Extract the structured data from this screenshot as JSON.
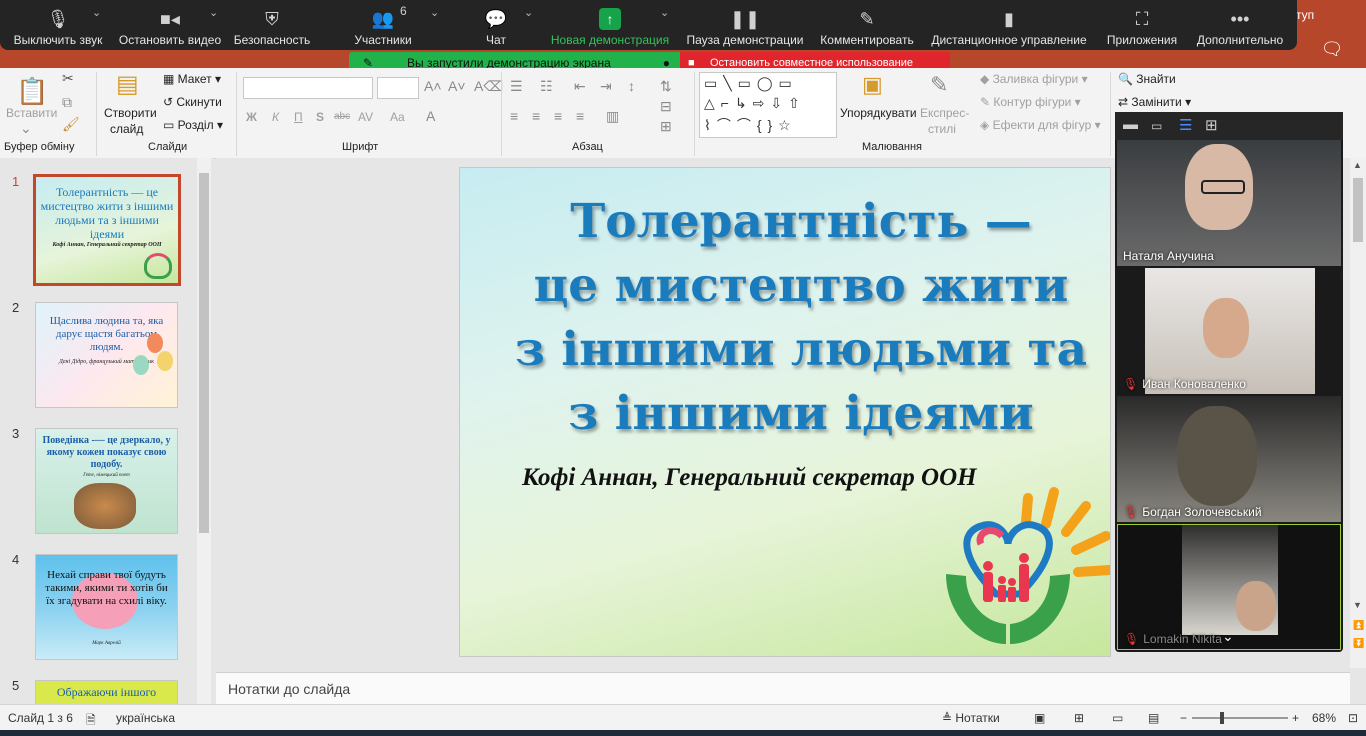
{
  "zoom": {
    "buttons": [
      {
        "label": "Выключить звук",
        "icon": "microphone-icon"
      },
      {
        "label": "Остановить видео",
        "icon": "video-camera-icon"
      },
      {
        "label": "Безопасность",
        "icon": "shield-icon"
      },
      {
        "label": "Участники",
        "icon": "participants-icon"
      },
      {
        "label": "Чат",
        "icon": "chat-icon"
      },
      {
        "label": "Новая демонстрация",
        "icon": "share-screen-icon"
      },
      {
        "label": "Пауза демонстрации",
        "icon": "pause-icon"
      },
      {
        "label": "Комментировать",
        "icon": "pen-icon"
      },
      {
        "label": "Дистанционное управление",
        "icon": "mouse-icon"
      },
      {
        "label": "Приложения",
        "icon": "apps-icon"
      },
      {
        "label": "Дополнительно",
        "icon": "more-icon"
      }
    ],
    "participant_count": "6",
    "banner_sharing": "Вы запустили демонстрацию экрана",
    "banner_stop": "Остановить совместное использование",
    "accent_green": "#22b24c",
    "accent_red": "#e0262c"
  },
  "ribbon": {
    "paste": "Вставити",
    "clipboard_group": "Буфер обміну",
    "new_slide": "Створити",
    "new_slide_2": "слайд",
    "layout": "Макет",
    "reset": "Скинути",
    "section": "Розділ",
    "slides_group": "Слайди",
    "font_group": "Шрифт",
    "bold": "Ж",
    "italic": "К",
    "underline": "П",
    "strike": "abc",
    "font_size_letters": "Aa",
    "paragraph_group": "Абзац",
    "arrange": "Упорядкувати",
    "quick_styles": "Експрес-",
    "quick_styles_2": "стилі",
    "shape_fill": "Заливка фігури",
    "shape_outline": "Контур фігури",
    "shape_effects": "Ефекти для фігур",
    "drawing_group": "Малювання",
    "find": "Знайти",
    "replace": "Замінити"
  },
  "thumbnails": [
    {
      "num": "1",
      "text": "Толерантність — це мистецтво жити з іншими людьми та з іншими ідеями",
      "sub": "Кофі Аннан, Генеральний секретар ООН"
    },
    {
      "num": "2",
      "text": "Щаслива людина та, яка дарує щастя багатьом людям.",
      "sub": "Дені Дідро, французький математик"
    },
    {
      "num": "3",
      "text": "Поведінка -— це дзеркало, у якому кожен показує свою подобу.",
      "sub": "Гете, німецький поет"
    },
    {
      "num": "4",
      "text": "Нехай справи твої будуть такими, якими ти хотів би їх згадувати на схилі віку.",
      "sub": "Марк Аврелій"
    },
    {
      "num": "5",
      "text": "Ображаючи іншого"
    }
  ],
  "slide": {
    "title_lines": [
      "Толерантність —",
      "це мистецтво жити",
      "з іншими людьми та",
      "з іншими ідеями"
    ],
    "quote": "Кофі Аннан, Генеральний секретар ООН"
  },
  "notes_placeholder": "Нотатки до слайда",
  "status": {
    "slide_counter": "Слайд 1 з 6",
    "language": "українська",
    "notes": "Нотатки",
    "zoom": "68%"
  },
  "gallery": {
    "participants": [
      {
        "name": "Наталя Анучина",
        "muted": false
      },
      {
        "name": "Иван Коноваленко",
        "muted": true
      },
      {
        "name": "Богдан Золочевський",
        "muted": true
      },
      {
        "name": "Lomakin Nikita",
        "muted": true
      }
    ]
  },
  "title_right": "ступ"
}
